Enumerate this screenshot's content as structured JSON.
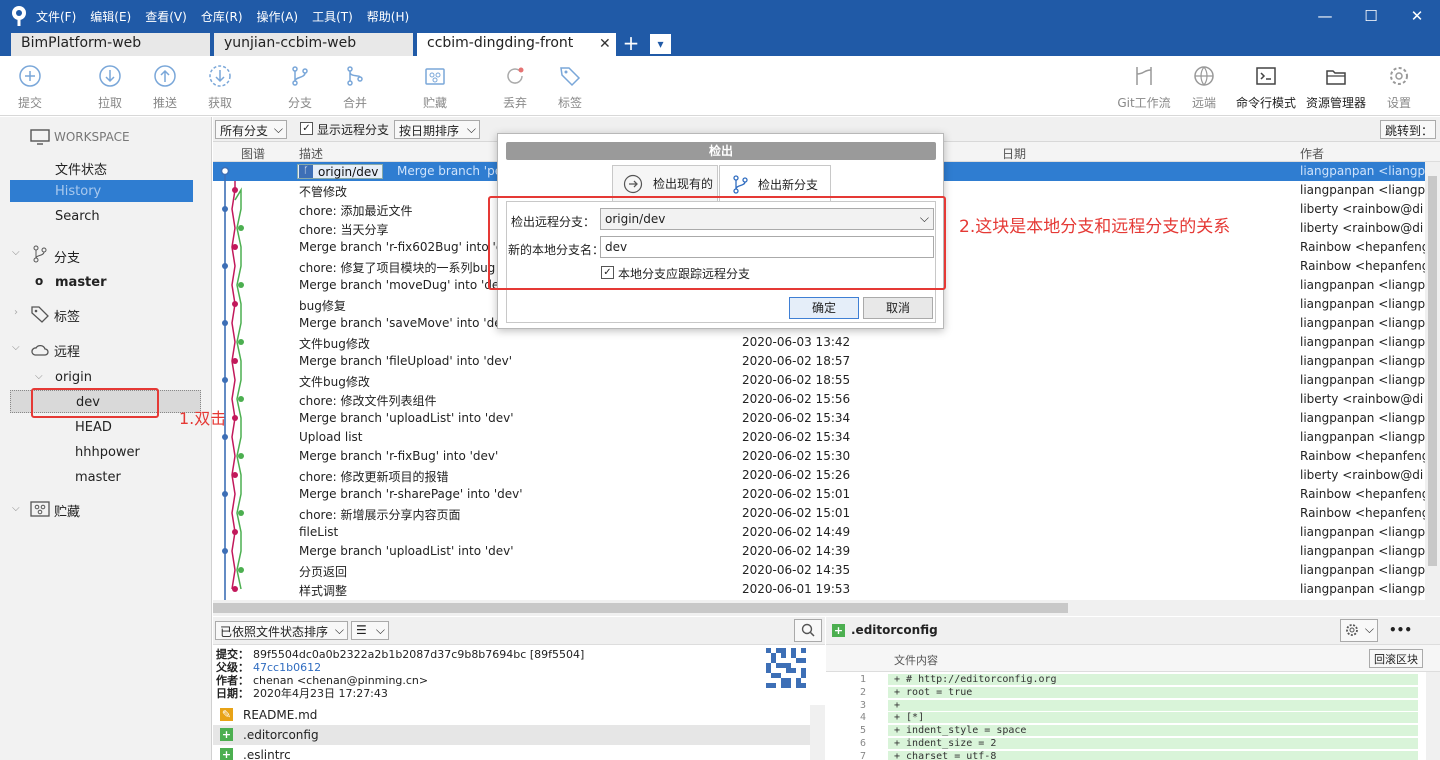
{
  "menus": [
    "文件(F)",
    "编辑(E)",
    "查看(V)",
    "仓库(R)",
    "操作(A)",
    "工具(T)",
    "帮助(H)"
  ],
  "window": {
    "min": "—",
    "max": "☐",
    "close": "✕"
  },
  "tabs": [
    {
      "label": "BimPlatform-web"
    },
    {
      "label": "yunjian-ccbim-web"
    },
    {
      "label": "ccbim-dingding-front",
      "close": "✕"
    }
  ],
  "tab_add": "+",
  "tab_menu": "▾",
  "toolbar": {
    "commit": "提交",
    "pull": "拉取",
    "push": "推送",
    "fetch": "获取",
    "branch": "分支",
    "merge": "合并",
    "stash": "贮藏",
    "discard": "丢弃",
    "tag": "标签",
    "gitflow": "Git工作流",
    "remote": "远端",
    "terminal": "命令行模式",
    "explorer": "资源管理器",
    "settings": "设置"
  },
  "sidebar": {
    "workspace": "WORKSPACE",
    "file_status": "文件状态",
    "history": "History",
    "search": "Search",
    "branches": "分支",
    "master": "master",
    "tags": "标签",
    "remotes": "远程",
    "origin": "origin",
    "remote_items": [
      "dev",
      "HEAD",
      "hhhpower",
      "master"
    ],
    "stashes": "贮藏"
  },
  "histtool": {
    "all_branches": "所有分支",
    "show_remote": "显示远程分支",
    "sort": "按日期排序",
    "jump": "跳转到："
  },
  "histhead": {
    "graph": "图谱",
    "desc": "描述",
    "date": "日期",
    "author": "作者"
  },
  "selected_row": {
    "branch_tag": "origin/dev",
    "message": "Merge branch 'pe",
    "author": "liangpanpan <liangpa"
  },
  "rows": [
    {
      "message": "不管修改",
      "date": "",
      "author": "liangpanpan <liangpa"
    },
    {
      "message": "chore: 添加最近文件",
      "date": "",
      "author": "liberty <rainbow@di"
    },
    {
      "message": "chore: 当天分享",
      "date": "",
      "author": "liberty <rainbow@di"
    },
    {
      "message": "Merge branch 'r-fix602Bug' into 'd",
      "date": "",
      "author": "Rainbow <hepanfeng"
    },
    {
      "message": "chore: 修复了项目模块的一系列bug",
      "date": "",
      "author": "Rainbow <hepanfeng"
    },
    {
      "message": "Merge branch 'moveDug' into 'de",
      "date": "",
      "author": "liangpanpan <liangpa"
    },
    {
      "message": "bug修复",
      "date": "",
      "author": "liangpanpan <liangpa"
    },
    {
      "message": "Merge branch 'saveMove' into 'de",
      "date": "",
      "author": "liangpanpan <liangpa"
    },
    {
      "message": "文件bug修改",
      "date": "2020-06-03 13:42",
      "author": "liangpanpan <liangpa"
    },
    {
      "message": "Merge branch 'fileUpload' into 'dev'",
      "date": "2020-06-02 18:57",
      "author": "liangpanpan <liangpa"
    },
    {
      "message": "文件bug修改",
      "date": "2020-06-02 18:55",
      "author": "liangpanpan <liangpa"
    },
    {
      "message": "chore: 修改文件列表组件",
      "date": "2020-06-02 15:56",
      "author": "liberty <rainbow@di"
    },
    {
      "message": "Merge branch 'uploadList' into 'dev'",
      "date": "2020-06-02 15:34",
      "author": "liangpanpan <liangpa"
    },
    {
      "message": "Upload list",
      "date": "2020-06-02 15:34",
      "author": "liangpanpan <liangpa"
    },
    {
      "message": "Merge branch 'r-fixBug' into 'dev'",
      "date": "2020-06-02 15:30",
      "author": "Rainbow <hepanfeng"
    },
    {
      "message": "chore: 修改更新项目的报错",
      "date": "2020-06-02 15:26",
      "author": "liberty <rainbow@di"
    },
    {
      "message": "Merge branch 'r-sharePage' into 'dev'",
      "date": "2020-06-02 15:01",
      "author": "Rainbow <hepanfeng"
    },
    {
      "message": "chore: 新增展示分享内容页面",
      "date": "2020-06-02 15:01",
      "author": "Rainbow <hepanfeng"
    },
    {
      "message": "fileList",
      "date": "2020-06-02 14:49",
      "author": "liangpanpan <liangpa"
    },
    {
      "message": "Merge branch 'uploadList' into 'dev'",
      "date": "2020-06-02 14:39",
      "author": "liangpanpan <liangpa"
    },
    {
      "message": "分页返回",
      "date": "2020-06-02 14:35",
      "author": "liangpanpan <liangpa"
    },
    {
      "message": "样式调整",
      "date": "2020-06-01 19:53",
      "author": "liangpanpan <liangpa"
    }
  ],
  "bottom": {
    "sort": "已依照文件状态排序",
    "list_mode": "☰",
    "commit_label": "提交：",
    "commit": "89f5504dc0a0b2322a2b1b2087d37c9b8b7694bc [89f5504]",
    "parent_label": "父级：",
    "parent": "47cc1b0612",
    "author_label": "作者：",
    "author": "chenan <chenan@pinming.cn>",
    "date_label": "日期：",
    "date": "2020年4月23日 17:27:43",
    "files": [
      {
        "name": "README.md",
        "status": "modified",
        "icon": "✎"
      },
      {
        "name": ".editorconfig",
        "status": "added",
        "icon": "+"
      },
      {
        "name": ".eslintrc",
        "status": "added",
        "icon": "+"
      }
    ]
  },
  "diff": {
    "file": ".editorconfig",
    "content_label": "文件内容",
    "revert": "回滚区块",
    "more": "•••",
    "lines": [
      {
        "n": "1",
        "t": "+ # http://editorconfig.org"
      },
      {
        "n": "2",
        "t": "+ root = true"
      },
      {
        "n": "3",
        "t": "+"
      },
      {
        "n": "4",
        "t": "+ [*]"
      },
      {
        "n": "5",
        "t": "+ indent_style = space"
      },
      {
        "n": "6",
        "t": "+ indent_size = 2"
      },
      {
        "n": "7",
        "t": "+ charset = utf-8"
      }
    ]
  },
  "dialog": {
    "title": "检出",
    "tab_existing": "检出现有的",
    "tab_new": "检出新分支",
    "remote_label": "检出远程分支：",
    "remote_value": "origin/dev",
    "local_label": "新的本地分支名：",
    "local_value": "dev",
    "track_label": "本地分支应跟踪远程分支",
    "ok": "确定",
    "cancel": "取消"
  },
  "annotations": {
    "step1": "1.双击",
    "step2": "2.这块是本地分支和远程分支的关系"
  },
  "colors": {
    "titlebar": "#205aa7",
    "selection": "#2f7dd1",
    "annotation": "#e53935",
    "graph_blue": "#3d6fb6",
    "graph_green": "#4caf50",
    "graph_red": "#c2185b"
  }
}
